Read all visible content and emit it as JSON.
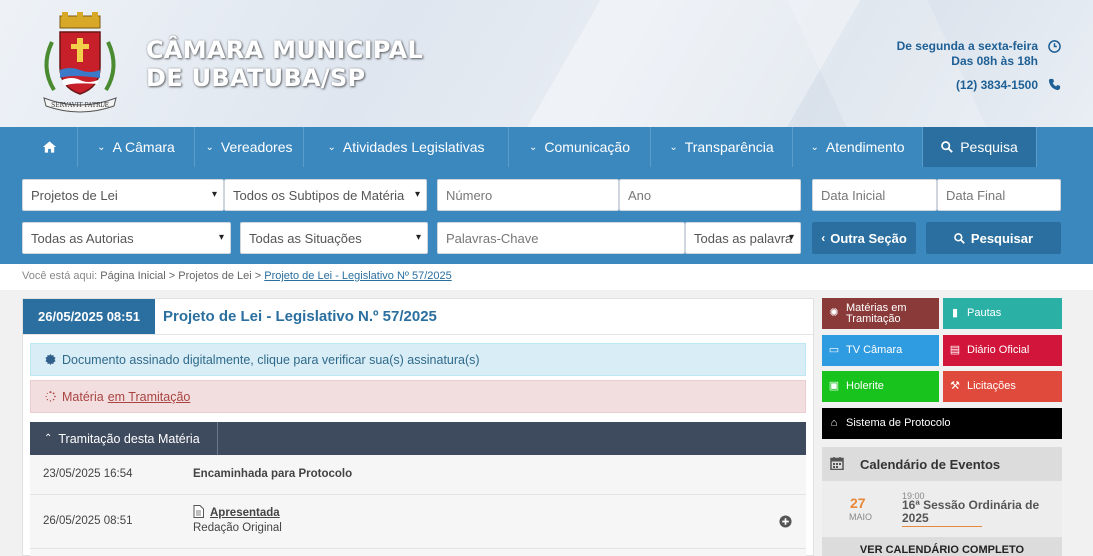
{
  "header": {
    "title_line1": "CÂMARA MUNICIPAL",
    "title_line2": "DE UBATUBA/SP",
    "hours_days": "De segunda a sexta-feira",
    "hours_time": "Das 08h às 18h",
    "phone": "(12) 3834-1500",
    "crest_motto": "SERVAVIT PATRIÆ"
  },
  "nav": {
    "items": [
      "A Câmara",
      "Vereadores",
      "Atividades Legislativas",
      "Comunicação",
      "Transparência",
      "Atendimento"
    ],
    "search_label": "Pesquisa"
  },
  "filters": {
    "tipo": "Projetos de Lei",
    "subtipo": "Todos os Subtipos de Matéria",
    "numero_placeholder": "Número",
    "ano_placeholder": "Ano",
    "data_inicial_placeholder": "Data Inicial",
    "data_final_placeholder": "Data Final",
    "autorias": "Todas as Autorias",
    "situacoes": "Todas as Situações",
    "palavras_placeholder": "Palavras-Chave",
    "palavra_mode": "Todas as palavra",
    "outra_secao_label": "Outra Seção",
    "pesquisar_label": "Pesquisar"
  },
  "breadcrumb": {
    "prefix": "Você está aqui:",
    "home": "Página Inicial",
    "section": "Projetos de Lei",
    "current": "Projeto de Lei - Legislativo Nº 57/2025",
    "sep": ">"
  },
  "doc": {
    "datetime": "26/05/2025 08:51",
    "title": "Projeto de Lei - Legislativo N.º 57/2025",
    "signed_alert": "Documento assinado digitalmente, clique para verificar sua(s) assinatura(s)",
    "status_prefix": "Matéria",
    "status_link": "em Tramitação",
    "tramitacao_tab": "Tramitação desta Matéria",
    "rows": [
      {
        "date": "23/05/2025 16:54",
        "desc": "Encaminhada para Protocolo"
      },
      {
        "date": "26/05/2025 08:51",
        "desc": "Apresentada",
        "sub": "Redação Original"
      }
    ]
  },
  "sidebar": {
    "tiles": [
      {
        "label": "Matérias em Tramitação",
        "color": "#8b3a3a"
      },
      {
        "label": "Pautas",
        "color": "#2bb0a6"
      },
      {
        "label": "TV Câmara",
        "color": "#2f9be0"
      },
      {
        "label": "Diário Oficial",
        "color": "#d2153a"
      },
      {
        "label": "Holerite",
        "color": "#18c31e"
      },
      {
        "label": "Licitações",
        "color": "#e04a3c"
      },
      {
        "label": "Sistema de Protocolo",
        "color": "#000000"
      }
    ],
    "calendar": {
      "title": "Calendário de Eventos",
      "day": "27",
      "month": "MAIO",
      "time": "19:00",
      "event": "16ª Sessão Ordinária de 2025",
      "button": "VER CALENDÁRIO COMPLETO"
    }
  },
  "colors": {
    "primary": "#3b88bf",
    "primary_dark": "#2a6f9f",
    "tramitacao_bar": "#3e4a5e"
  }
}
